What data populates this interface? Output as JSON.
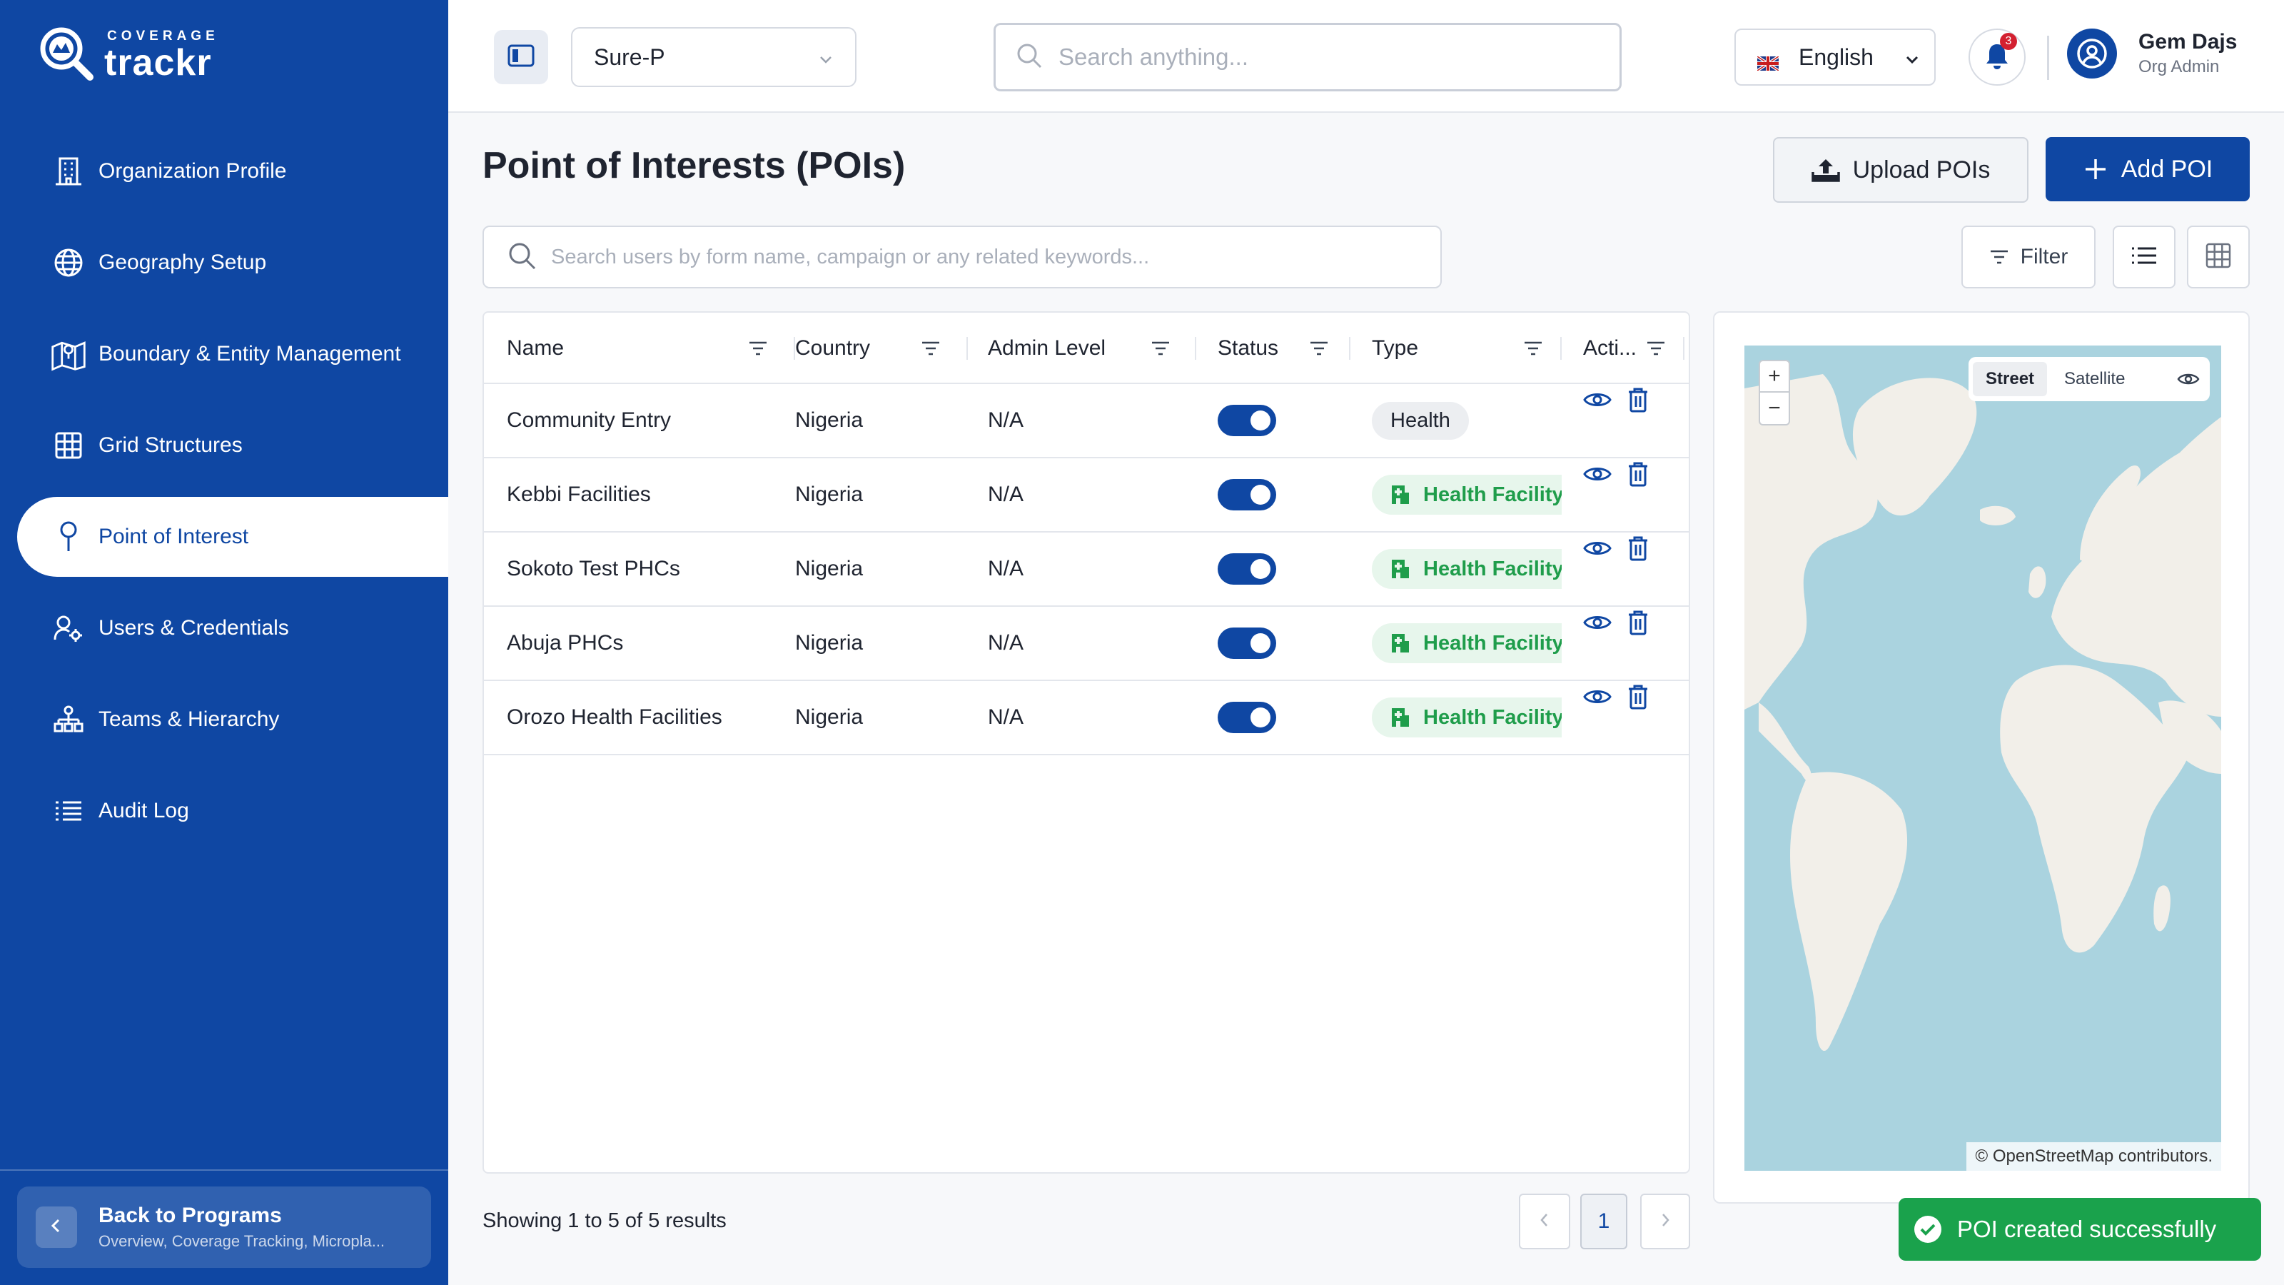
{
  "brand": {
    "small": "COVERAGE",
    "big": "trackr"
  },
  "sidebar": {
    "items": [
      {
        "label": "Organization Profile",
        "icon": "building-icon"
      },
      {
        "label": "Geography Setup",
        "icon": "globe-icon"
      },
      {
        "label": "Boundary & Entity Management",
        "icon": "map-pin-icon"
      },
      {
        "label": "Grid Structures",
        "icon": "grid-icon"
      },
      {
        "label": "Point of Interest",
        "icon": "location-pin-icon",
        "active": true
      },
      {
        "label": "Users & Credentials",
        "icon": "user-gear-icon"
      },
      {
        "label": "Teams & Hierarchy",
        "icon": "hierarchy-icon"
      },
      {
        "label": "Audit Log",
        "icon": "list-icon"
      }
    ],
    "back": {
      "title": "Back to Programs",
      "subtitle": "Overview, Coverage Tracking, Micropla..."
    }
  },
  "topbar": {
    "program": "Sure-P",
    "search_placeholder": "Search anything...",
    "language": "English",
    "notifications_count": "3",
    "user": {
      "name": "Gem Dajs",
      "role": "Org Admin"
    }
  },
  "page": {
    "title": "Point of Interests (POIs)",
    "upload_label": "Upload POIs",
    "add_label": "Add POI",
    "search_placeholder": "Search users by form name, campaign or any related keywords...",
    "filter_label": "Filter"
  },
  "table": {
    "columns": [
      "Name",
      "Country",
      "Admin Level",
      "Status",
      "Type",
      "Acti..."
    ],
    "rows": [
      {
        "name": "Community Entry",
        "country": "Nigeria",
        "admin_level": "N/A",
        "status": true,
        "type": "Health",
        "type_style": "plain"
      },
      {
        "name": "Kebbi Facilities",
        "country": "Nigeria",
        "admin_level": "N/A",
        "status": true,
        "type": "Health Facility",
        "type_style": "facility"
      },
      {
        "name": "Sokoto Test PHCs",
        "country": "Nigeria",
        "admin_level": "N/A",
        "status": true,
        "type": "Health Facility",
        "type_style": "facility"
      },
      {
        "name": "Abuja PHCs",
        "country": "Nigeria",
        "admin_level": "N/A",
        "status": true,
        "type": "Health Facility",
        "type_style": "facility"
      },
      {
        "name": "Orozo Health Facilities",
        "country": "Nigeria",
        "admin_level": "N/A",
        "status": true,
        "type": "Health Facility",
        "type_style": "facility"
      }
    ]
  },
  "pagination": {
    "summary": "Showing 1 to 5 of 5 results",
    "current_page": "1"
  },
  "map": {
    "street_label": "Street",
    "satellite_label": "Satellite",
    "attribution_link": "© OpenStreetMap",
    "attribution_rest": " contributors."
  },
  "toast": {
    "message": "POI created successfully"
  },
  "colors": {
    "primary": "#0f47a3",
    "success": "#1aa24c",
    "facility_text": "#1f9d4b",
    "water": "#aad3df",
    "land": "#f2efe9"
  }
}
